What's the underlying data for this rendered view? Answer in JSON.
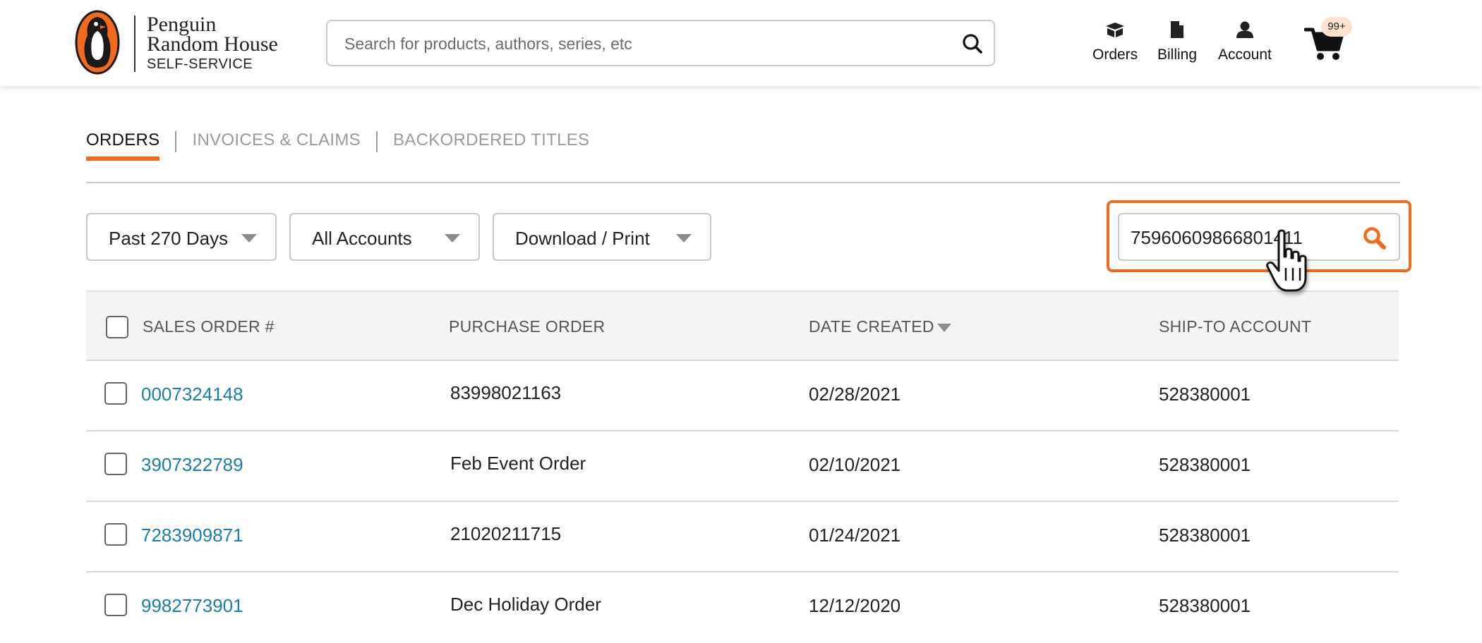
{
  "header": {
    "brand_line1": "Penguin",
    "brand_line2": "Random House",
    "brand_sub": "SELF-SERVICE",
    "search_placeholder": "Search for products, authors, series, etc",
    "nav": {
      "orders": "Orders",
      "billing": "Billing",
      "account": "Account"
    },
    "cart_badge": "99+"
  },
  "tabs": [
    {
      "label": "ORDERS",
      "active": true
    },
    {
      "label": "INVOICES & CLAIMS",
      "active": false
    },
    {
      "label": "BACKORDERED TITLES",
      "active": false
    }
  ],
  "filters": {
    "days": "Past 270 Days",
    "accounts": "All Accounts",
    "download": "Download / Print",
    "order_search_value": "75960609866801411"
  },
  "table": {
    "headers": {
      "sales_order": "SALES ORDER #",
      "purchase_order": "PURCHASE ORDER",
      "date_created": "DATE CREATED",
      "ship_to": "SHIP-TO ACCOUNT"
    },
    "rows": [
      {
        "sales_order": "0007324148",
        "purchase_order": "83998021163",
        "date_created": "02/28/2021",
        "ship_to": "528380001"
      },
      {
        "sales_order": "3907322789",
        "purchase_order": "Feb Event Order",
        "date_created": "02/10/2021",
        "ship_to": "528380001"
      },
      {
        "sales_order": "7283909871",
        "purchase_order": "21020211715",
        "date_created": "01/24/2021",
        "ship_to": "528380001"
      },
      {
        "sales_order": "9982773901",
        "purchase_order": "Dec Holiday Order",
        "date_created": "12/12/2020",
        "ship_to": "528380001"
      }
    ]
  },
  "colors": {
    "accent": "#f26b1d",
    "link": "#1a7fa8",
    "header_bg": "#f4f4f4"
  }
}
